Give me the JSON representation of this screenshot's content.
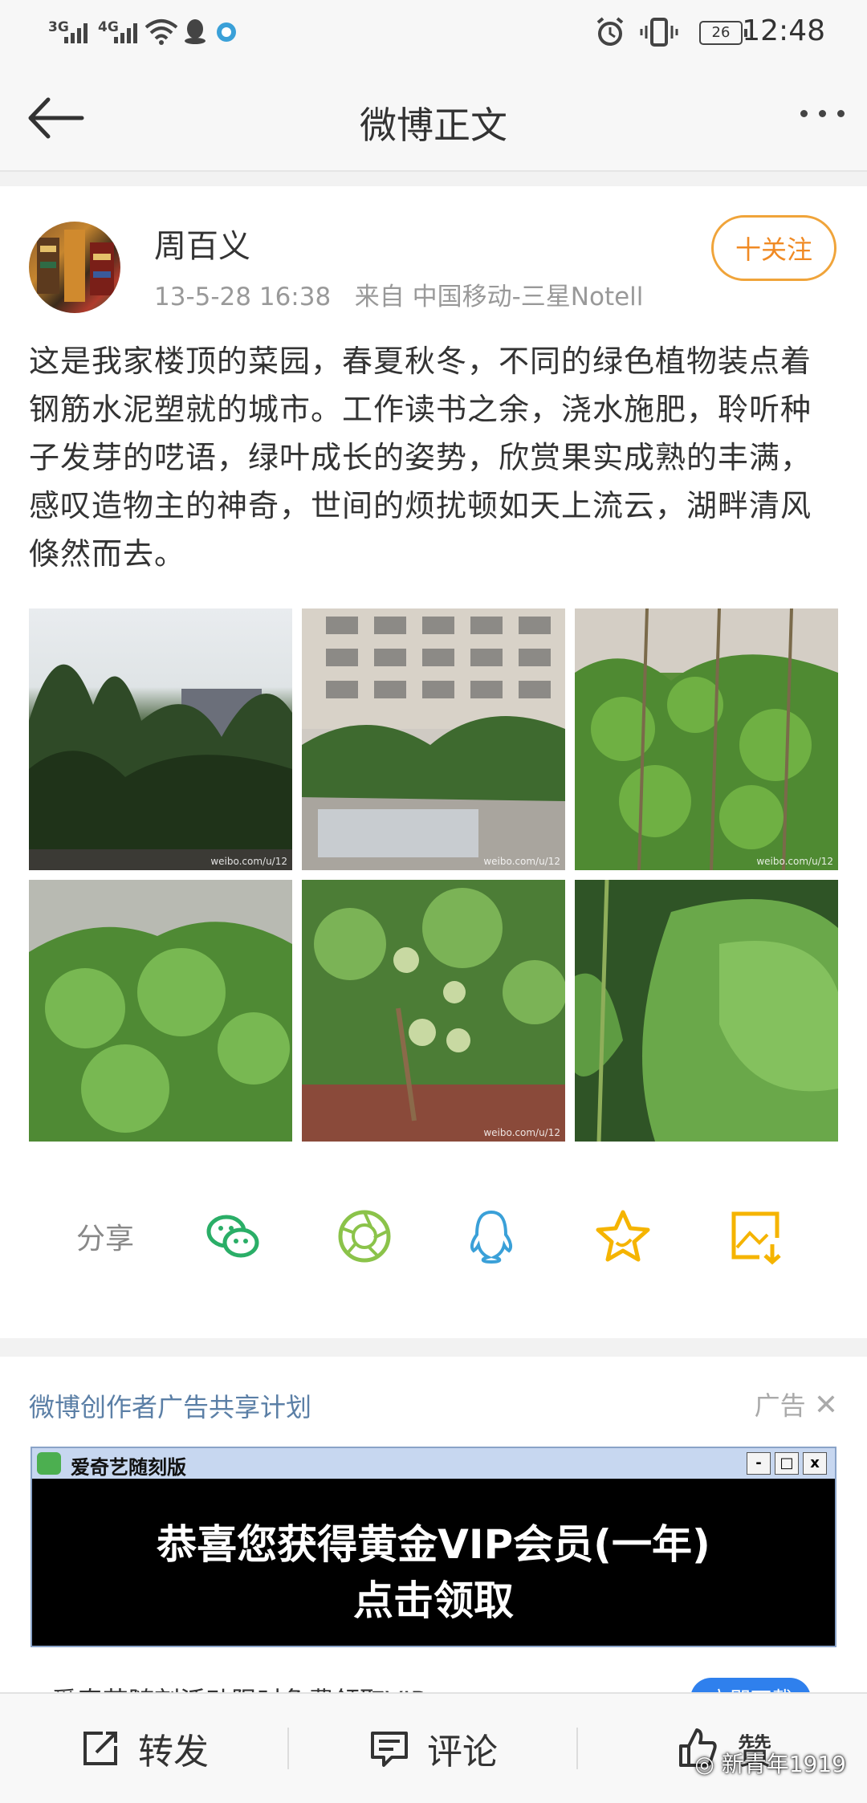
{
  "status_bar": {
    "signal1": "3G",
    "signal2": "4G",
    "battery": "26",
    "time": "12:48"
  },
  "header": {
    "title": "微博正文"
  },
  "post": {
    "author": "周百义",
    "timestamp": "13-5-28 16:38",
    "source": "来自 中国移动-三星Notell",
    "follow_label": "十关注",
    "text": "这是我家楼顶的菜园，春夏秋冬，不同的绿色植物装点着钢筋水泥塑就的城市。工作读书之余，浇水施肥，聆听种子发芽的呓语，绿叶成长的姿势，欣赏果实成熟的丰满，感叹造物主的神奇，世间的烦扰顿如天上流云，湖畔清风倏然而去。",
    "photo_watermark": "weibo.com/u/12"
  },
  "share": {
    "label": "分享",
    "icons": [
      "wechat-icon",
      "moments-icon",
      "qq-icon",
      "favorite-star-icon",
      "save-image-icon"
    ]
  },
  "ad": {
    "title": "微博创作者广告共享计划",
    "tag": "广告",
    "app_name": "爱奇艺随刻版",
    "headline1": "恭喜您获得黄金VIP会员(一年)",
    "headline2": "点击领取",
    "subtext": "爱奇艺随刻活动限时免费领取VIP",
    "button": "立即下载"
  },
  "bottom_bar": {
    "repost": "转发",
    "comment": "评论",
    "like": "赞"
  },
  "overlay_watermark": "新青年1919",
  "colors": {
    "accent_orange": "#f08a24",
    "ad_title_blue": "#5b7fa6",
    "wechat_green": "#2aae67",
    "moments_green": "#8bc34a",
    "qq_blue": "#3aa0d8",
    "star_yellow": "#f5b400"
  }
}
